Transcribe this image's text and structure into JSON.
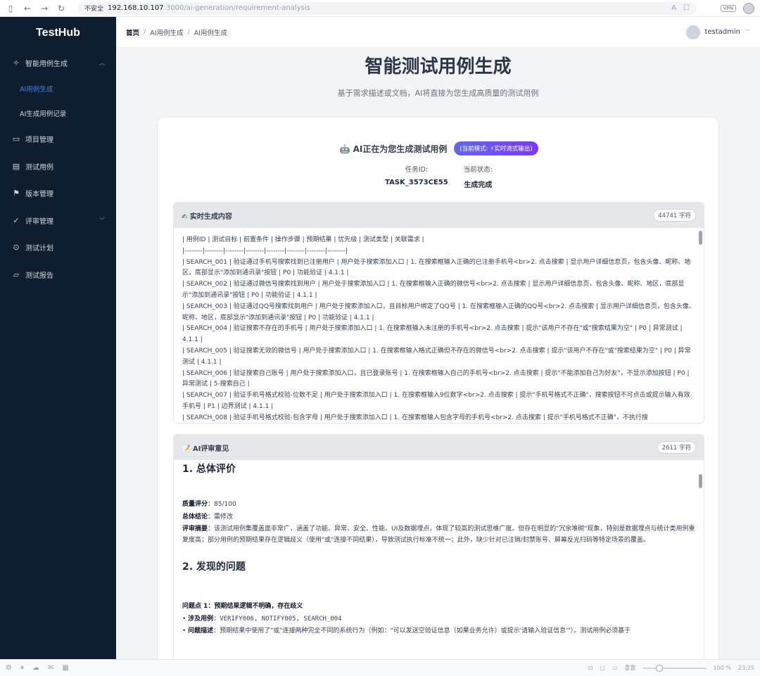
{
  "browser": {
    "security": "不安全",
    "host": "192.168.10.107",
    "path": ":3000/ai-generation/requirement-analysis",
    "vpn": "VPN"
  },
  "sidebar": {
    "logo": "TestHub",
    "items": [
      {
        "label": "智能用例生成",
        "icon": "sparkle-icon",
        "expanded": true
      },
      {
        "label": "项目管理",
        "icon": "folder-icon"
      },
      {
        "label": "测试用例",
        "icon": "document-icon"
      },
      {
        "label": "版本管理",
        "icon": "flag-icon"
      },
      {
        "label": "评审管理",
        "icon": "check-icon"
      },
      {
        "label": "测试计划",
        "icon": "play-circle-icon"
      },
      {
        "label": "测试报告",
        "icon": "presentation-icon"
      }
    ],
    "sub_items": [
      {
        "label": "AI用例生成",
        "active": true
      },
      {
        "label": "AI生成用例记录",
        "active": false
      }
    ]
  },
  "header": {
    "breadcrumb": [
      "首页",
      "AI用例生成",
      "AI用例生成"
    ],
    "username": "testadmin"
  },
  "page": {
    "title": "智能测试用例生成",
    "subtitle": "基于需求描述或文档，AI将直接为您生成高质量的测试用例"
  },
  "status": {
    "heading": "🤖 AI正在为您生成测试用例",
    "mode": "(当前模式: ⚡实时流式输出)",
    "task_label": "任务ID:",
    "task_value": "TASK_3573CE55",
    "state_label": "当前状态:",
    "state_value": "生成完成"
  },
  "realtime": {
    "title": "✍ 实时生成内容",
    "count": "44741 字符",
    "lines": [
      "| 用例ID | 测试目标 | 前置条件 | 操作步骤 | 预期结果 | 优先级 | 测试类型 | 关联需求 |",
      "|--------|--------|--------|--------|--------|--------|--------|--------|",
      "| SEARCH_001 | 验证通过手机号搜索找到已注册用户 | 用户处于搜索添加入口 | 1. 在搜索框输入正确的已注册手机号<br>2. 点击搜索 | 显示用户详细信息页，包含头像、昵称、地区，底部显示\"添加到通讯录\"按钮 | P0 | 功能验证 | 4.1.1 |",
      "| SEARCH_002 | 验证通过微信号搜索找到用户 | 用户处于搜索添加入口 | 1. 在搜索框输入正确的微信号<br>2. 点击搜索 | 显示用户详细信息页，包含头像、昵称、地区，底部显示\"添加到通讯录\"按钮 | P0 | 功能验证 | 4.1.1 |",
      "| SEARCH_003 | 验证通过QQ号搜索找到用户 | 用户处于搜索添加入口，且目标用户绑定了QQ号 | 1. 在搜索框输入正确的QQ号<br>2. 点击搜索 | 显示用户详细信息页，包含头像、昵称、地区，底部显示\"添加到通讯录\"按钮 | P0 | 功能验证 | 4.1.1 |",
      "| SEARCH_004 | 验证搜索不存在的手机号 | 用户处于搜索添加入口 | 1. 在搜索框输入未注册的手机号<br>2. 点击搜索 | 提示\"该用户不存在\"或\"搜索结果为空\" | P0 | 异常测试 | 4.1.1 |",
      "| SEARCH_005 | 验证搜索无效的微信号 | 用户处于搜索添加入口 | 1. 在搜索框输入格式正确但不存在的微信号<br>2. 点击搜索 | 提示\"该用户不存在\"或\"搜索结果为空\" | P0 | 异常测试 | 4.1.1 |",
      "| SEARCH_006 | 验证搜索自己账号 | 用户处于搜索添加入口，且已登录账号 | 1. 在搜索框输入自己的手机号<br>2. 点击搜索 | 提示\"不能添加自己为好友\"，不显示添加按钮 | P0 | 异常测试 | 5-搜索自己 |",
      "| SEARCH_007 | 验证手机号格式校验-位数不足 | 用户处于搜索添加入口 | 1. 在搜索框输入9位数字<br>2. 点击搜索 | 提示\"手机号格式不正确\"，搜索按钮不可点击或提示输入有效手机号 | P1 | 边界测试 | 4.1.1 |",
      "| SEARCH_008 | 验证手机号格式校验-包含字母 | 用户处于搜索添加入口 | 1. 在搜索框输入包含字母的手机号<br>2. 点击搜索 | 提示\"手机号格式不正确\"，不执行搜"
    ]
  },
  "review": {
    "title": "📝 AI评审意见",
    "count": "2611 字符",
    "h_overall": "1. 总体评价",
    "score_label": "质量评分",
    "score_value": "85/100",
    "conclusion_label": "总体结论",
    "conclusion_value": "需修改",
    "summary_label": "评审摘要",
    "summary_value": "该测试用例集覆盖面非常广，涵盖了功能、异常、安全、性能、UI及数据埋点，体现了较高的测试思维广度。但存在明显的\"冗余堆砌\"现象，特别是数据埋点与统计类用例重复度高；部分用例的预期结果存在逻辑歧义（使用\"或\"连接不同结果），导致测试执行标准不统一；此外，缺少针对已注销/封禁账号、屏幕反光扫码等特定场景的覆盖。",
    "h_issues": "2. 发现的问题",
    "issue1_title": "问题点 1：预期结果逻辑不明确，存在歧义",
    "issue1_cases_label": "涉及用例",
    "issue1_cases_value": "VERIFY006, NOTIFY005, SEARCH_004",
    "issue1_desc_label": "问题描述",
    "issue1_desc_value": "预期结果中使用了\"或\"连接两种完全不同的系统行为（例如：\"可以发送空验证信息（如果业务允许）或提示'请输入验证信息'\"）。测试用例必须基于"
  },
  "statusbar": {
    "zoom_label": "重置",
    "zoom": "100 %",
    "zoom_level": 0.2,
    "time": "23:25"
  }
}
